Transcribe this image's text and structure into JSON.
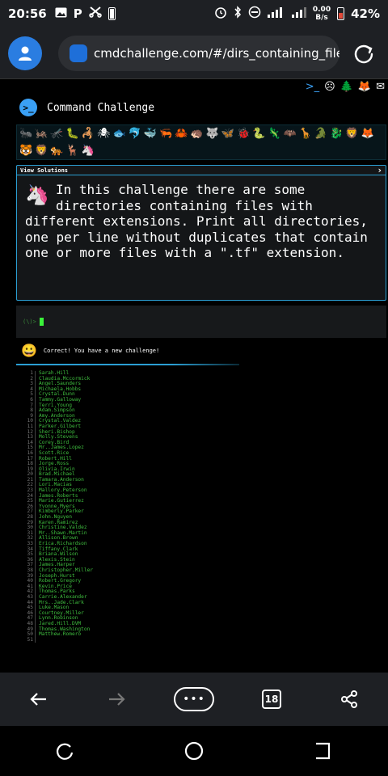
{
  "status_bar": {
    "time": "20:56",
    "data_speed": "0.00",
    "data_speed_unit": "B/s",
    "battery_percent": "42%"
  },
  "browser": {
    "url": "cmdchallenge.com/#/dirs_containing_files.",
    "tab_count": "18"
  },
  "page": {
    "title": "Command Challenge",
    "view_solutions_label": "View Solutions",
    "challenge_description": "In this challenge there are some directories containing files with different extensions. Print all directories, one per line without duplicates that contain one or more files with a \".tf\" extension.",
    "prompt": "(\\)>",
    "correct_message": "Correct! You have a new challenge!",
    "results": [
      {
        "n": "1",
        "v": "Sarah.Hill"
      },
      {
        "n": "2",
        "v": "Claudia.Mccormick"
      },
      {
        "n": "3",
        "v": "Angel.Saunders"
      },
      {
        "n": "4",
        "v": "Michaela.Hobbs"
      },
      {
        "n": "5",
        "v": "Crystal.Dunn"
      },
      {
        "n": "6",
        "v": "Tammy.Galloway"
      },
      {
        "n": "7",
        "v": "Terri.Young"
      },
      {
        "n": "8",
        "v": "Adam.Simpson"
      },
      {
        "n": "9",
        "v": "Amy.Anderson"
      },
      {
        "n": "10",
        "v": "Crystal.Valdez"
      },
      {
        "n": "11",
        "v": "Parker.Gilbert"
      },
      {
        "n": "12",
        "v": "Sheri.Bishop"
      },
      {
        "n": "13",
        "v": "Molly.Stevens"
      },
      {
        "n": "14",
        "v": "Corey.Bird"
      },
      {
        "n": "15",
        "v": "Mr..James.Lopez"
      },
      {
        "n": "16",
        "v": "Scott.Rice"
      },
      {
        "n": "17",
        "v": "Robert.Hill"
      },
      {
        "n": "18",
        "v": "Jorge.Ross"
      },
      {
        "n": "19",
        "v": "Olivia.Irwin"
      },
      {
        "n": "20",
        "v": "Brad.Michael"
      },
      {
        "n": "21",
        "v": "Tamara.Anderson"
      },
      {
        "n": "22",
        "v": "Lori.Macias"
      },
      {
        "n": "23",
        "v": "Mallory.Peterson"
      },
      {
        "n": "24",
        "v": "James.Roberts"
      },
      {
        "n": "25",
        "v": "Marie.Gutierrez"
      },
      {
        "n": "26",
        "v": "Yvonne.Myers"
      },
      {
        "n": "27",
        "v": "Kimberly.Parker"
      },
      {
        "n": "28",
        "v": "John.Nguyen"
      },
      {
        "n": "29",
        "v": "Karen.Ramirez"
      },
      {
        "n": "30",
        "v": "Christine.Valdez"
      },
      {
        "n": "31",
        "v": "Mr..Shawn.Martin"
      },
      {
        "n": "32",
        "v": "Allison.Brown"
      },
      {
        "n": "33",
        "v": "Erica.Richardson"
      },
      {
        "n": "34",
        "v": "Tiffany.Clark"
      },
      {
        "n": "35",
        "v": "Briana.Wilson"
      },
      {
        "n": "36",
        "v": "Alexis.Stein"
      },
      {
        "n": "37",
        "v": "James.Harper"
      },
      {
        "n": "38",
        "v": "Christopher.Miller"
      },
      {
        "n": "39",
        "v": "Joseph.Hurst"
      },
      {
        "n": "40",
        "v": "Robert.Gregory"
      },
      {
        "n": "41",
        "v": "Kevin.Price"
      },
      {
        "n": "42",
        "v": "Thomas.Parks"
      },
      {
        "n": "43",
        "v": "Carrie.Alexander"
      },
      {
        "n": "44",
        "v": "Mrs..Jade.Clark"
      },
      {
        "n": "45",
        "v": "Luke.Mason"
      },
      {
        "n": "46",
        "v": "Courtney.Miller"
      },
      {
        "n": "47",
        "v": "Lynn.Robinson"
      },
      {
        "n": "48",
        "v": "Jared.Hill.DVM"
      },
      {
        "n": "49",
        "v": "Thomas.Washington"
      },
      {
        "n": "50",
        "v": "Matthew.Romero"
      },
      {
        "n": "51",
        "v": ""
      }
    ]
  },
  "colors": {
    "accent_blue": "#2b9fd3",
    "terminal_green": "#3fbf3f",
    "browser_bar": "#1e2024",
    "profile_blue": "#2a7de1"
  },
  "icons": {
    "top_right": [
      "terminal-icon",
      "smiley-icon",
      "tree-icon",
      "fox-icon",
      "mail-icon"
    ],
    "animals": [
      "🐜",
      "🦗",
      "🦟",
      "🐛",
      "🦂",
      "🕷",
      "🐟",
      "🐬",
      "🐳",
      "🦐",
      "🦀",
      "🦔",
      "🐺",
      "🦋",
      "🐞",
      "🐍",
      "🦎",
      "🦇",
      "🦒",
      "🐊",
      "🐉",
      "🦁",
      "🦊",
      "🐯",
      "🦁",
      "🐅",
      "🦌",
      "🦄"
    ]
  }
}
